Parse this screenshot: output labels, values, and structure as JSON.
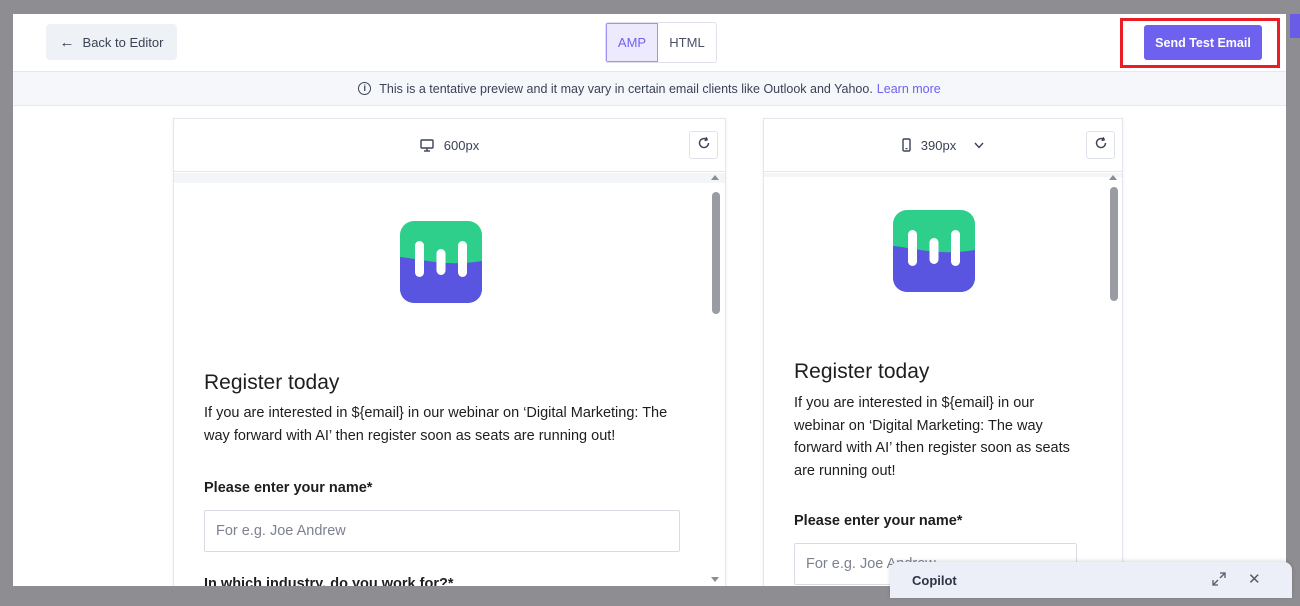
{
  "header": {
    "back_label": "Back to Editor",
    "back_icon": "arrow-left-icon",
    "view_toggle": [
      {
        "label": "AMP",
        "selected": true
      },
      {
        "label": "HTML",
        "selected": false
      }
    ],
    "send_label": "Send Test Email"
  },
  "notice": {
    "text": "This is a tentative preview and it may vary in certain email clients like Outlook and Yahoo.",
    "link": "Learn more",
    "icon": "info-icon"
  },
  "desktop_preview": {
    "width_label": "600px",
    "device_icon": "monitor-icon",
    "email": {
      "heading": "Register today",
      "body": "If you are interested in ${email} in our webinar on ‘Digital Marketing: The way forward with AI’ then register soon as seats are running out!",
      "name_label": "Please enter your name*",
      "name_placeholder": "For e.g. Joe Andrew",
      "industry_label": "In which industry, do you work for?*"
    }
  },
  "mobile_preview": {
    "width_label": "390px",
    "device_icon": "phone-icon",
    "email": {
      "heading": "Register today",
      "body": "If you are interested in ${email} in our webinar on ‘Digital Marketing: The way forward with AI’ then register soon as seats are running out!",
      "name_label": "Please enter your name*",
      "name_placeholder": "For e.g. Joe Andrew"
    }
  },
  "copilot": {
    "title": "Copilot"
  },
  "colors": {
    "accent": "#6e61f0",
    "highlight": "#ea1c24",
    "logo_green": "#2ecf8b",
    "logo_purple": "#5a55e0"
  }
}
